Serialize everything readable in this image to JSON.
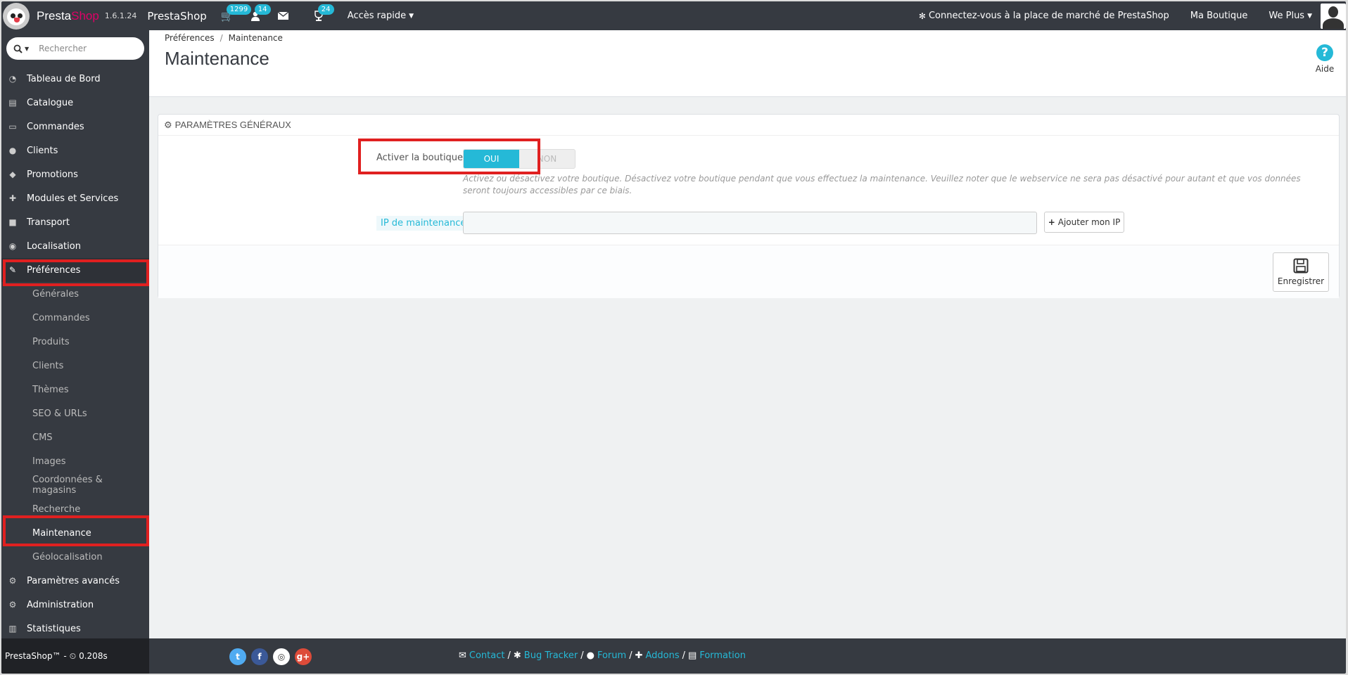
{
  "header": {
    "brand_part1": "Presta",
    "brand_part2": "Shop",
    "version": "1.6.1.24",
    "shop_name": "PrestaShop",
    "orders_badge": "1299",
    "customers_badge": "14",
    "trophy_badge": "24",
    "quick_access": "Accès rapide",
    "marketplace": "Connectez-vous à la place de marché de PrestaShop",
    "my_shop": "Ma Boutique",
    "user": "We Plus"
  },
  "sidebar": {
    "search_placeholder": "Rechercher",
    "items": [
      {
        "label": "Tableau de Bord",
        "icon": "dashboard-icon"
      },
      {
        "label": "Catalogue",
        "icon": "book-icon"
      },
      {
        "label": "Commandes",
        "icon": "credit-card-icon"
      },
      {
        "label": "Clients",
        "icon": "users-icon"
      },
      {
        "label": "Promotions",
        "icon": "tags-icon"
      },
      {
        "label": "Modules et Services",
        "icon": "puzzle-icon"
      },
      {
        "label": "Transport",
        "icon": "truck-icon"
      },
      {
        "label": "Localisation",
        "icon": "globe-icon"
      },
      {
        "label": "Préférences",
        "icon": "wrench-icon"
      }
    ],
    "sub_items": [
      "Générales",
      "Commandes",
      "Produits",
      "Clients",
      "Thèmes",
      "SEO & URLs",
      "CMS",
      "Images",
      "Coordonnées & magasins",
      "Recherche",
      "Maintenance",
      "Géolocalisation"
    ],
    "bottom_items": [
      {
        "label": "Paramètres avancés",
        "icon": "cogs-icon"
      },
      {
        "label": "Administration",
        "icon": "cog-icon"
      },
      {
        "label": "Statistiques",
        "icon": "bar-chart-icon"
      }
    ]
  },
  "page": {
    "breadcrumb_parent": "Préférences",
    "breadcrumb_current": "Maintenance",
    "title": "Maintenance",
    "help_label": "Aide"
  },
  "panel": {
    "heading": "PARAMÈTRES GÉNÉRAUX",
    "enable_label": "Activer la boutique",
    "switch_on": "OUI",
    "switch_off": "NON",
    "help_text": "Activez ou désactivez votre boutique. Désactivez votre boutique pendant que vous effectuez la maintenance. Veuillez noter que le webservice ne sera pas désactivé pour autant et que vos données seront toujours accessibles par ce biais.",
    "ip_label": "IP de maintenance",
    "ip_value": "",
    "add_ip_button": "Ajouter mon IP",
    "save_button": "Enregistrer"
  },
  "footer": {
    "left_text": "PrestaShop™ - ",
    "load_time": "0.208s",
    "links": [
      "Contact",
      "Bug Tracker",
      "Forum",
      "Addons",
      "Formation"
    ]
  },
  "colors": {
    "accent": "#25b9d7",
    "sidebar_bg": "#363a41",
    "highlight_red": "#e02020"
  }
}
